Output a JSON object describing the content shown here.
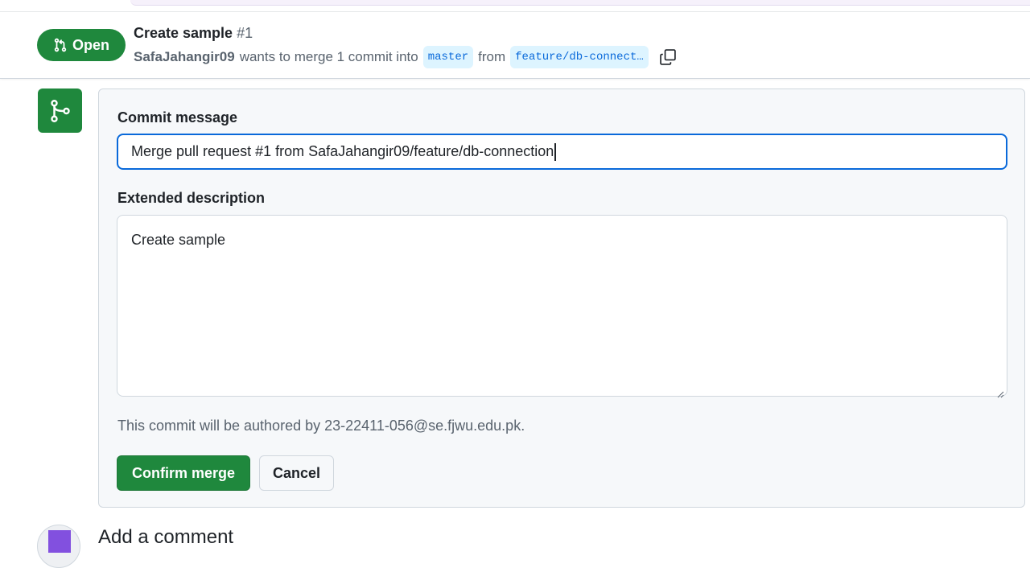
{
  "pr": {
    "state": "Open",
    "title": "Create sample",
    "number": "#1",
    "author": "SafaJahangir09",
    "merge_text": "wants to merge 1 commit into",
    "base_branch": "master",
    "from_text": "from",
    "head_branch": "feature/db-connect…"
  },
  "merge_form": {
    "commit_message_label": "Commit message",
    "commit_message_value": "Merge pull request #1 from SafaJahangir09/feature/db-connection",
    "extended_description_label": "Extended description",
    "extended_description_value": "Create sample",
    "author_note": "This commit will be authored by 23-22411-056@se.fjwu.edu.pk.",
    "confirm_label": "Confirm merge",
    "cancel_label": "Cancel"
  },
  "comment": {
    "heading": "Add a comment"
  },
  "icons": {
    "state": "git-pull-request-icon",
    "copy": "copy-icon",
    "merge": "git-merge-icon",
    "resize": "resize-grip-icon"
  },
  "colors": {
    "open_green": "#1f883d",
    "accent_blue": "#0969da",
    "branch_bg": "#ddf4ff",
    "muted_text": "#59636e"
  }
}
